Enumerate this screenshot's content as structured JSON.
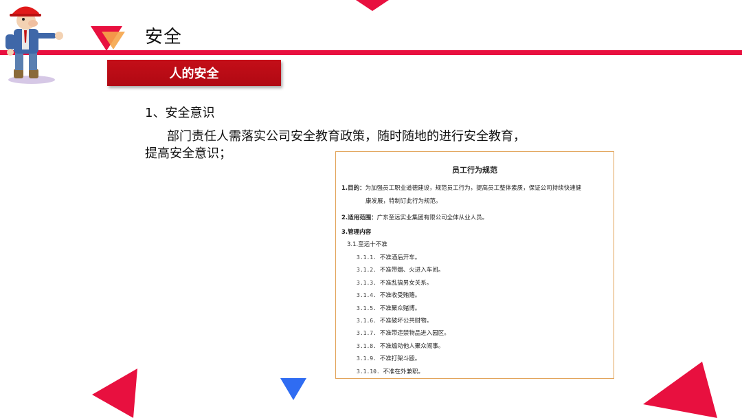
{
  "header": {
    "title": "安全",
    "section_label": "人的安全"
  },
  "content": {
    "item_heading": "1、安全意识",
    "paragraph_line1": "部门责任人需落实公司安全教育政策，随时随地的进行安全教育，",
    "paragraph_line2": "提高安全意识；"
  },
  "document": {
    "title": "员工行为规范",
    "purpose_label": "1.目的：",
    "purpose_text_1": "为加强员工职业道德建设，规范员工行为，提高员工整体素质，保证公司持续快速健",
    "purpose_text_2": "康发展，特制订此行为规范。",
    "scope_label": "2.适用范围：",
    "scope_text": "广东至远实业集团有限公司全体从业人员。",
    "content_label": "3.管理内容",
    "sub_heading": "3.1.至远十不准",
    "rules": [
      {
        "num": "3.1.1.",
        "text": "不准酒后开车。"
      },
      {
        "num": "3.1.2.",
        "text": "不准带烟、火进入车间。"
      },
      {
        "num": "3.1.3.",
        "text": "不准乱搞男女关系。"
      },
      {
        "num": "3.1.4.",
        "text": "不准收受贿赂。"
      },
      {
        "num": "3.1.5.",
        "text": "不准聚众赌博。"
      },
      {
        "num": "3.1.6.",
        "text": "不准破坏公共财物。"
      },
      {
        "num": "3.1.7.",
        "text": "不准带违禁物品进入园区。"
      },
      {
        "num": "3.1.8.",
        "text": "不准煽动他人聚众闹事。"
      },
      {
        "num": "3.1.9.",
        "text": "不准打架斗殴。"
      },
      {
        "num": "3.1.10.",
        "text": "不准在外兼职。"
      }
    ]
  },
  "colors": {
    "accent_red": "#e8103f",
    "banner_red": "#c40e18",
    "accent_blue": "#2f6cf2",
    "accent_orange": "#f5a54a",
    "doc_border": "#e2a45a"
  },
  "icons": {
    "mascot": "worker-mascot-icon"
  }
}
